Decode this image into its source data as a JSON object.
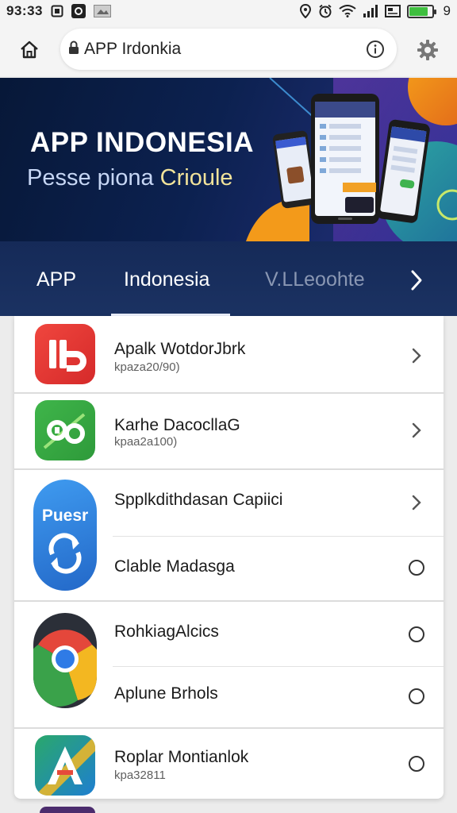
{
  "status_bar": {
    "time": "93:33",
    "battery_suffix": "9",
    "battery_level": 0.85
  },
  "browser": {
    "url_text": "APP Irdonkia"
  },
  "hero": {
    "title": "APP INDONESIA",
    "subtitle_part1": "Pesse piona ",
    "subtitle_part2": "Crioule"
  },
  "tabs": [
    {
      "label": "APP"
    },
    {
      "label": "Indonesia",
      "active": true
    },
    {
      "label": "V.LLeoohte"
    }
  ],
  "list": {
    "items": [
      {
        "title": "Apalk WotdorJbrk",
        "subtitle": "kpaza20/90)",
        "action": "chevron-right"
      },
      {
        "title": "Karhe DacocllaG",
        "subtitle": "kpaa2a100)",
        "action": "chevron-right"
      },
      {
        "title": "Spplkdithdasan Capiici",
        "action": "chevron-right"
      },
      {
        "title": "Clable Madasga",
        "action": "circle-open"
      },
      {
        "title": "RohkiagAlcics",
        "action": "circle-open"
      },
      {
        "title": "Aplune Brhols",
        "action": "circle-open"
      },
      {
        "title": "Roplar Montianlok",
        "subtitle": "kpa32811",
        "action": "circle-open"
      }
    ],
    "icon_texts": {
      "booster": "Puesr"
    }
  },
  "colors": {
    "accent": "#1b3262",
    "hero_bg": "#0c2150",
    "red_app": "#e53935",
    "green_app": "#43a047",
    "blue_app": "#1e88e5"
  }
}
